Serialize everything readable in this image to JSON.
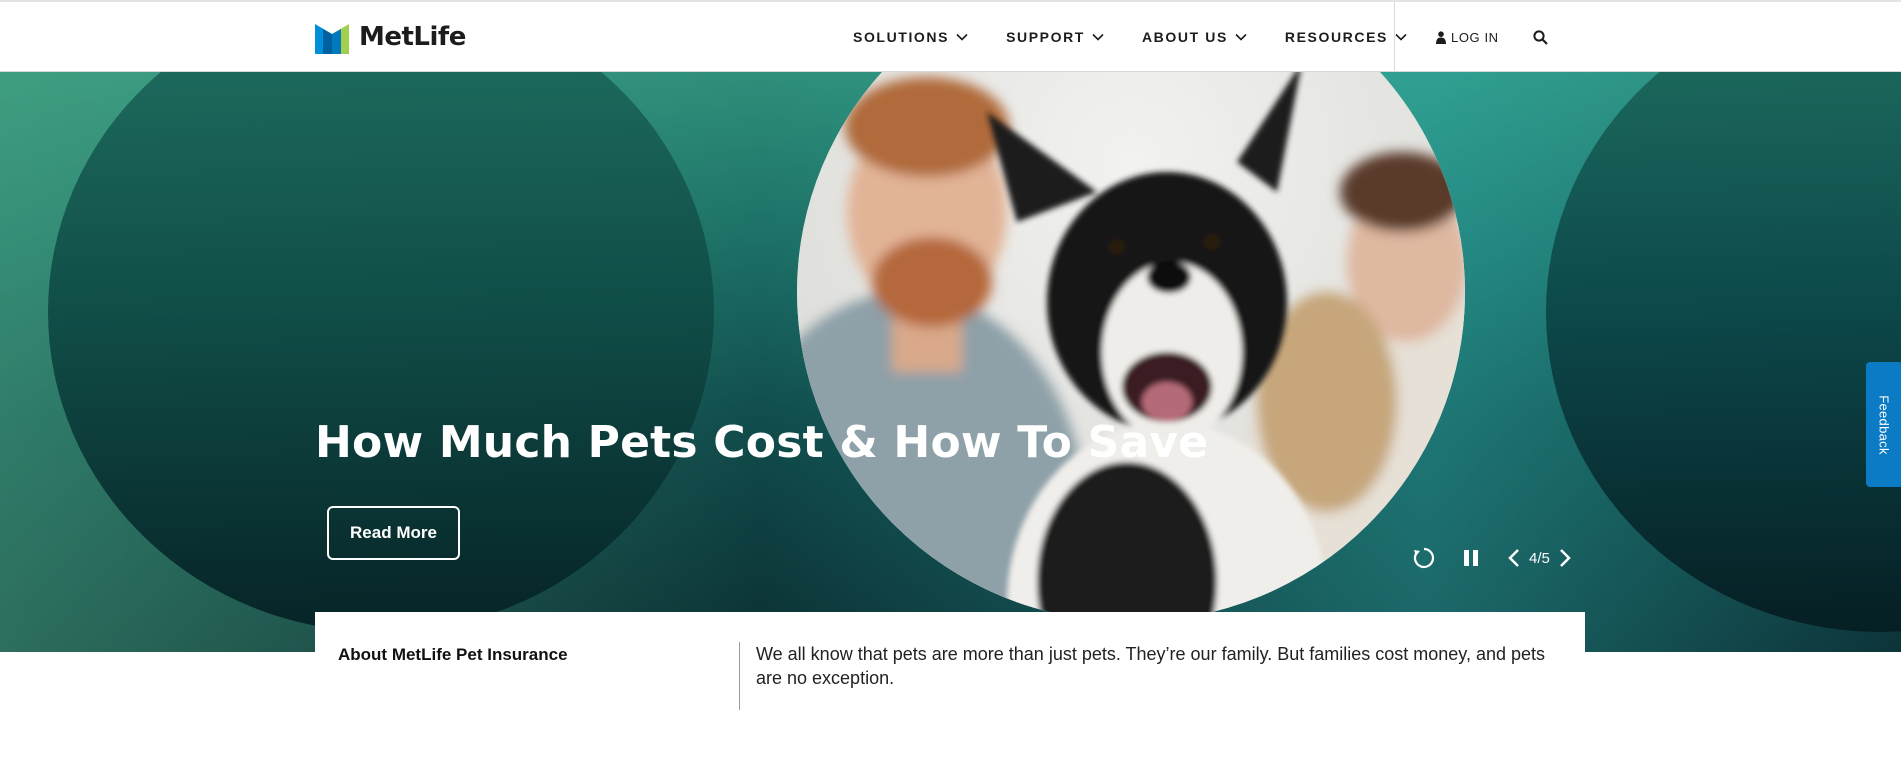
{
  "header": {
    "brand": "MetLife",
    "nav": [
      {
        "label": "SOLUTIONS"
      },
      {
        "label": "SUPPORT"
      },
      {
        "label": "ABOUT US"
      },
      {
        "label": "RESOURCES"
      }
    ],
    "login_label": "LOG IN",
    "icons": {
      "login": "user-icon",
      "search": "search-icon",
      "nav": "chevron-down-icon"
    }
  },
  "hero": {
    "title": "How Much Pets Cost & How To Save",
    "cta_label": "Read More",
    "slide_counter": "4/5",
    "controls": [
      "replay-icon",
      "pause-icon",
      "chevron-left-icon",
      "chevron-right-icon"
    ]
  },
  "feedback": {
    "label": "Feedback"
  },
  "info": {
    "heading": "About MetLife Pet Insurance",
    "text": "We all know that pets are more than just pets. They’re our family. But families cost money, and pets are no exception."
  },
  "colors": {
    "brand_blue": "#0090da",
    "brand_green": "#a4ce4e",
    "feedback_blue": "#0a7bc4",
    "hero_teal": "#1a6b63"
  }
}
